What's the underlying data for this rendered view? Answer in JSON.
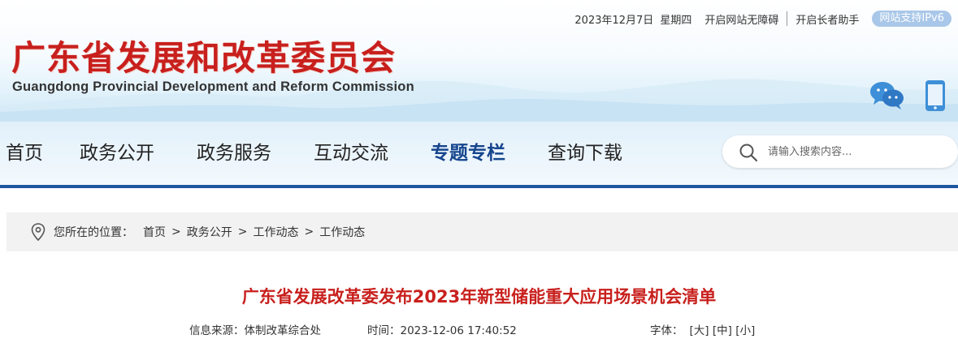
{
  "topbar": {
    "date": "2023年12月7日",
    "weekday": "星期四",
    "accessibility": "开启网站无障碍",
    "elder_mode": "开启长者助手",
    "ipv6": "网站支持IPv6"
  },
  "logo": {
    "cn": "广东省发展和改革委员会",
    "en": "Guangdong Provincial Development and Reform Commission"
  },
  "header_icons": [
    "wechat-icon",
    "mobile-icon"
  ],
  "nav": {
    "items": [
      {
        "label": "首页",
        "active": false
      },
      {
        "label": "政务公开",
        "active": false
      },
      {
        "label": "政务服务",
        "active": false
      },
      {
        "label": "互动交流",
        "active": false
      },
      {
        "label": "专题专栏",
        "active": true
      },
      {
        "label": "查询下载",
        "active": false
      }
    ],
    "search_placeholder": "请输入搜索内容..."
  },
  "breadcrumb": {
    "label": "您所在的位置：",
    "items": [
      "首页",
      "政务公开",
      "工作动态",
      "工作动态"
    ],
    "separator": ">"
  },
  "article": {
    "title": "广东省发展改革委发布2023年新型储能重大应用场景机会清单",
    "source": "信息来源：体制改革综合处",
    "time": "时间：2023-12-06 17:40:52",
    "font_label": "字体：",
    "font_large": "[大]",
    "font_medium": "[中]",
    "font_small": "[小]"
  },
  "colors": {
    "brand_red": "#c8201d",
    "nav_blue": "#1e56a0",
    "active_nav": "#15458d"
  }
}
